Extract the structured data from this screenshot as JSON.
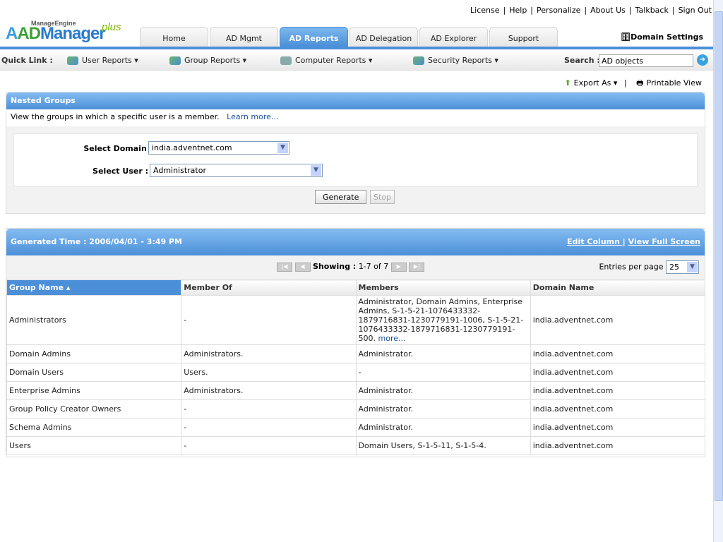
{
  "top_links": [
    "License",
    "Help",
    "Personalize",
    "About Us",
    "Talkback",
    "Sign Out"
  ],
  "logo": {
    "vendor": "ManageEngine",
    "ad": "AD",
    "product": "Manager",
    "plus": "plus"
  },
  "tabs": [
    {
      "label": "Home"
    },
    {
      "label": "AD Mgmt"
    },
    {
      "label": "AD Reports",
      "active": true
    },
    {
      "label": "AD Delegation"
    },
    {
      "label": "AD Explorer"
    },
    {
      "label": "Support"
    }
  ],
  "domain_settings": "Domain Settings",
  "quick": {
    "label": "Quick Link :",
    "items": [
      "User Reports ▾",
      "Group Reports ▾",
      "Computer Reports ▾",
      "Security Reports ▾"
    ],
    "search_label": "Search :",
    "search_value": "AD objects"
  },
  "export": {
    "export_as": "Export As ▾",
    "sep": "|",
    "printable": "Printable View"
  },
  "nested": {
    "title": "Nested Groups",
    "description": "View the groups in which a specific user is a member.",
    "learn_more": "Learn more...",
    "domain_label": "Select Domain :",
    "domain_value": "india.adventnet.com",
    "user_label": "Select User :",
    "user_value": "Administrator",
    "generate": "Generate",
    "stop": "Stop"
  },
  "results": {
    "generated": "Generated Time : 2006/04/01 - 3:49 PM",
    "edit_column": "Edit Column ",
    "sep": "|",
    "full_screen": "View Full Screen",
    "showing_label": "Showing :",
    "showing_value": "1-7 of 7",
    "entries_label": "Entries per page",
    "entries_value": "25",
    "columns": [
      "Group Name ▴",
      "Member Of",
      "Members",
      "Domain Name"
    ],
    "rows": [
      [
        "Administrators",
        "-",
        "Administrator, Domain Admins, Enterprise Admins, S-1-5-21-1076433332-1879716831-1230779191-1006, S-1-5-21-1076433332-1879716831-1230779191-500.",
        "india.adventnet.com"
      ],
      [
        "Domain Admins",
        "Administrators.",
        "Administrator.",
        "india.adventnet.com"
      ],
      [
        "Domain Users",
        "Users.",
        "-",
        "india.adventnet.com"
      ],
      [
        "Enterprise Admins",
        "Administrators.",
        "Administrator.",
        "india.adventnet.com"
      ],
      [
        "Group Policy Creator Owners",
        "-",
        "Administrator.",
        "india.adventnet.com"
      ],
      [
        "Schema Admins",
        "-",
        "Administrator.",
        "india.adventnet.com"
      ],
      [
        "Users",
        "-",
        "Domain Users, S-1-5-11, S-1-5-4.",
        "india.adventnet.com"
      ]
    ],
    "more": "more..."
  }
}
